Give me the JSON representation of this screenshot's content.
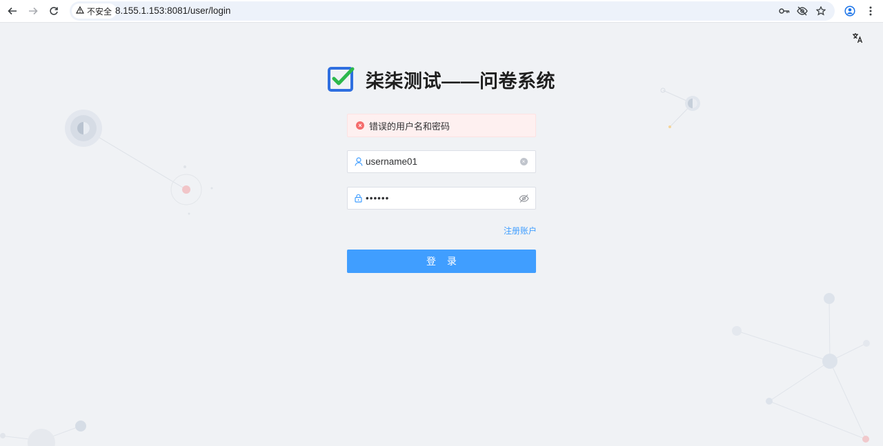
{
  "browser": {
    "security_label": "不安全",
    "url": "8.155.1.153:8081/user/login",
    "icons": {
      "back": "back-arrow-icon",
      "forward": "forward-arrow-icon",
      "reload": "reload-icon",
      "warning": "warning-triangle-icon",
      "key": "key-icon",
      "eye_off": "eye-off-icon",
      "star": "star-icon",
      "profile": "profile-icon",
      "menu": "more-vertical-icon"
    }
  },
  "page": {
    "app_title": "柒柒测试——问卷系统",
    "error_message": "错误的用户名和密码",
    "username_value": "username01",
    "password_masked": "••••••",
    "register_link": "注册账户",
    "login_button": "登 录"
  },
  "colors": {
    "primary": "#409eff",
    "error": "#f56c6c",
    "error_bg": "#fef0f0",
    "logo_blue": "#2f6fe0",
    "logo_green": "#2db84c"
  }
}
